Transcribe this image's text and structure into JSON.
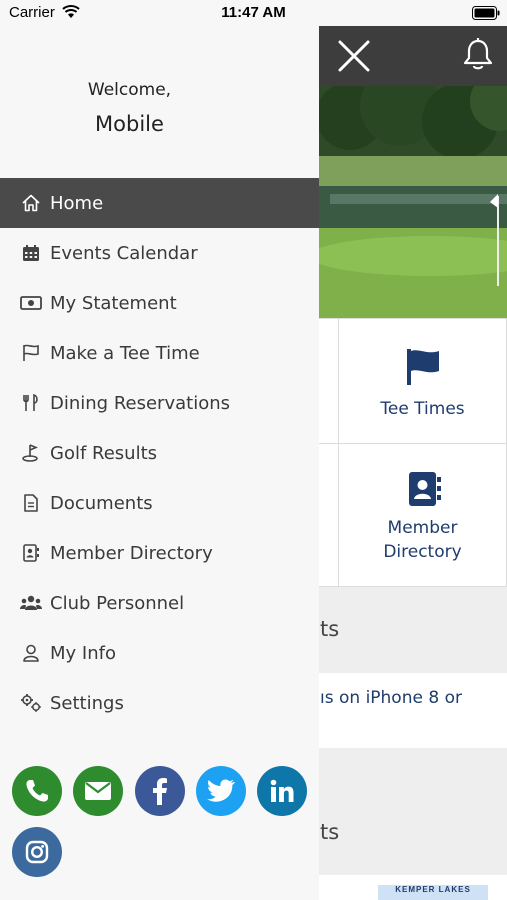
{
  "status_bar": {
    "carrier": "Carrier",
    "time": "11:47 AM"
  },
  "drawer": {
    "welcome": "Welcome,",
    "user_name": "Mobile",
    "menu": [
      {
        "label": "Home",
        "icon": "home-icon",
        "active": true
      },
      {
        "label": "Events Calendar",
        "icon": "calendar-icon",
        "active": false
      },
      {
        "label": "My Statement",
        "icon": "money-icon",
        "active": false
      },
      {
        "label": "Make a Tee Time",
        "icon": "flag-icon",
        "active": false
      },
      {
        "label": "Dining Reservations",
        "icon": "fork-knife-icon",
        "active": false
      },
      {
        "label": "Golf Results",
        "icon": "golf-icon",
        "active": false
      },
      {
        "label": "Documents",
        "icon": "document-icon",
        "active": false
      },
      {
        "label": "Member Directory",
        "icon": "directory-icon",
        "active": false
      },
      {
        "label": "Club Personnel",
        "icon": "people-icon",
        "active": false
      },
      {
        "label": "My Info",
        "icon": "user-icon",
        "active": false
      },
      {
        "label": "Settings",
        "icon": "gears-icon",
        "active": false
      }
    ],
    "social": [
      {
        "name": "phone-icon",
        "color": "#2e8b2e"
      },
      {
        "name": "email-icon",
        "color": "#2e8b2e"
      },
      {
        "name": "facebook-icon",
        "color": "#3b5998"
      },
      {
        "name": "twitter-icon",
        "color": "#1da1f2"
      },
      {
        "name": "linkedin-icon",
        "color": "#0e76a8"
      },
      {
        "name": "instagram-icon",
        "color": "#3d6a9e"
      }
    ]
  },
  "background": {
    "tiles": {
      "tee_times": "Tee Times",
      "member_directory_line1": "Member",
      "member_directory_line2": "Directory"
    },
    "section1_partial": "ts",
    "news_partial_line1": "ıs on iPhone 8 or",
    "section2_partial": "ts",
    "banner_partial": "KEMPER LAKES"
  },
  "colors": {
    "header_bg": "#3d3d3d",
    "active_menu_bg": "#4a4a4a",
    "drawer_bg": "#f7f7f7",
    "accent_navy": "#1f3c6e"
  }
}
